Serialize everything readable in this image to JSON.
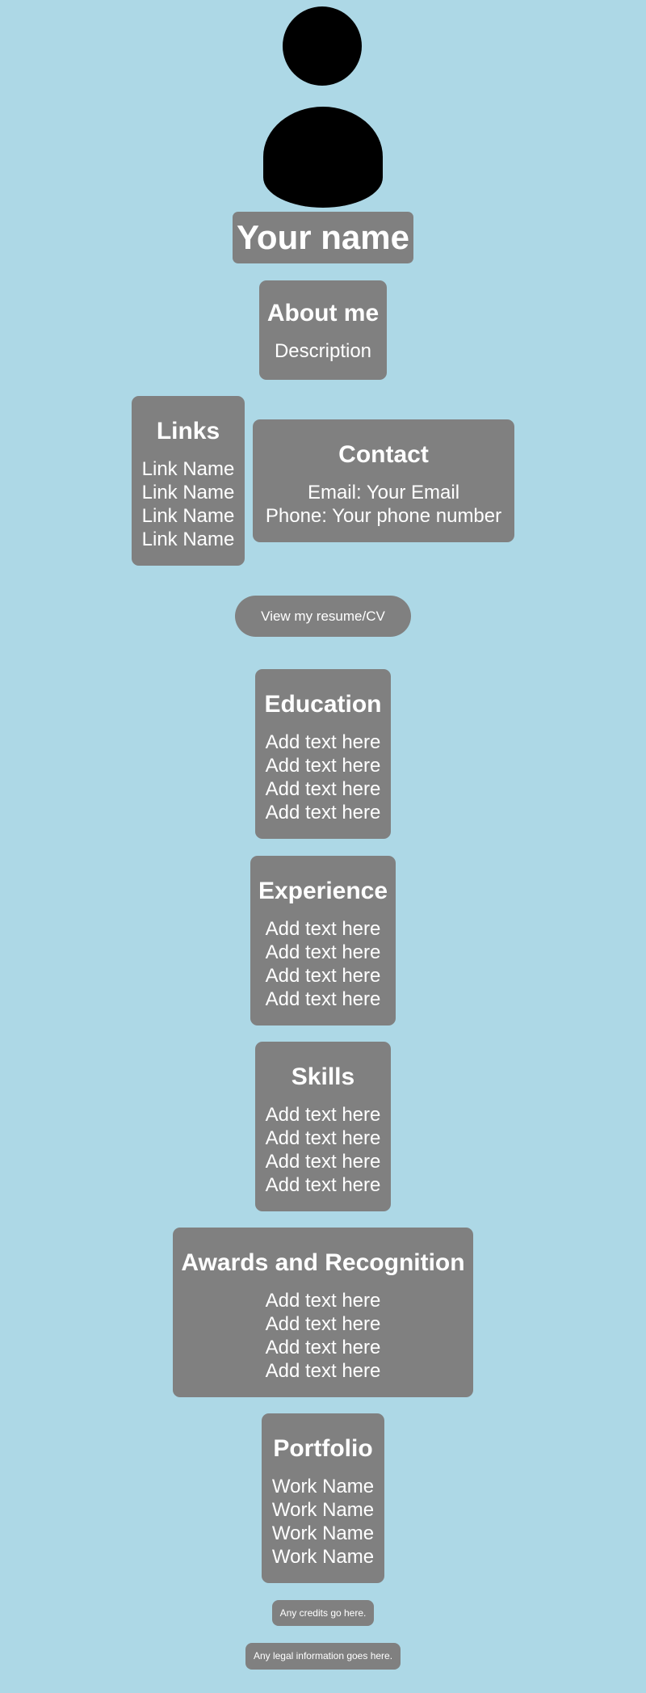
{
  "profile": {
    "name": "Your name"
  },
  "about": {
    "title": "About me",
    "description": "Description"
  },
  "links": {
    "title": "Links",
    "items": [
      "Link Name",
      "Link Name",
      "Link Name",
      "Link Name"
    ]
  },
  "contact": {
    "title": "Contact",
    "email": "Email: Your Email",
    "phone": "Phone: Your phone number"
  },
  "resume_button": {
    "label": "View my resume/CV"
  },
  "education": {
    "title": "Education",
    "items": [
      "Add text here",
      "Add text here",
      "Add text here",
      "Add text here"
    ]
  },
  "experience": {
    "title": "Experience",
    "items": [
      "Add text here",
      "Add text here",
      "Add text here",
      "Add text here"
    ]
  },
  "skills": {
    "title": "Skills",
    "items": [
      "Add text here",
      "Add text here",
      "Add text here",
      "Add text here"
    ]
  },
  "awards": {
    "title": "Awards and Recognition",
    "items": [
      "Add text here",
      "Add text here",
      "Add text here",
      "Add text here"
    ]
  },
  "portfolio": {
    "title": "Portfolio",
    "items": [
      "Work Name",
      "Work Name",
      "Work Name",
      "Work Name"
    ]
  },
  "footer": {
    "credits": "Any credits go here.",
    "legal": "Any legal information goes here."
  },
  "colors": {
    "background": "#add8e6",
    "card": "#808080",
    "text": "#ffffff",
    "avatar": "#000000"
  }
}
